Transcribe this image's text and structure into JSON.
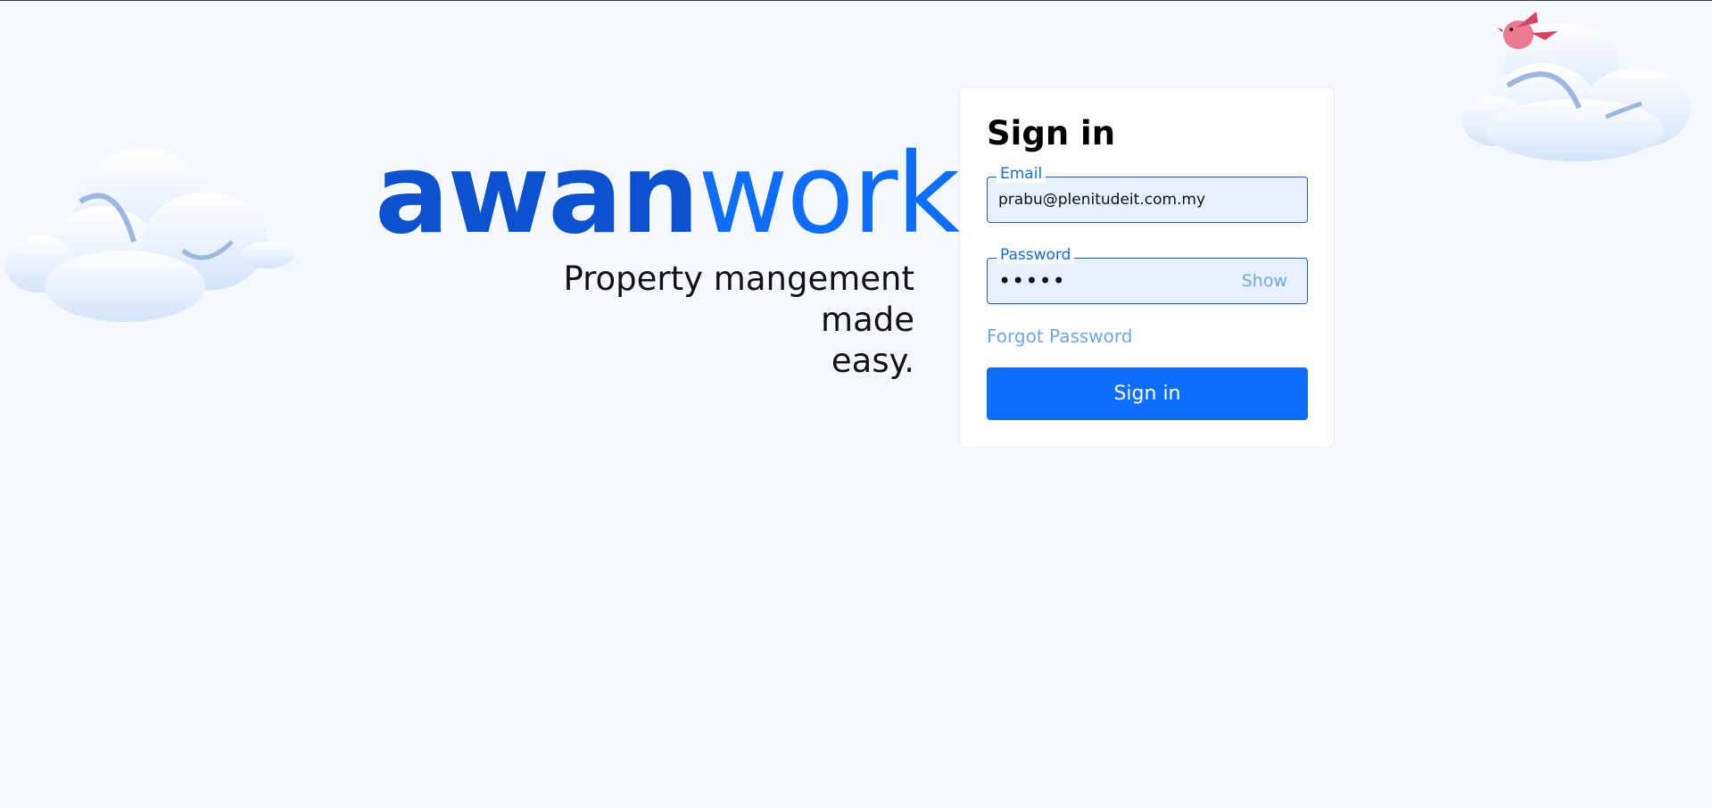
{
  "brand": {
    "logo_part1": "awan",
    "logo_part2": "works",
    "tagline_line1": "Property mangement made",
    "tagline_line2": "easy."
  },
  "signin": {
    "title": "Sign in",
    "email_label": "Email",
    "email_value": "prabu@plenitudeit.com.my",
    "password_label": "Password",
    "password_value": "•••••",
    "show_label": "Show",
    "forgot_label": "Forgot Password",
    "submit_label": "Sign in"
  },
  "colors": {
    "background": "#f5f9fe",
    "brand_dark": "#0a52d1",
    "brand_primary": "#0d6efd",
    "link": "#6ea8e8",
    "field_bg": "#e8f0fe"
  },
  "decor": {
    "left_icon": "cloud-icon",
    "right_icon": "cloud-icon",
    "bird_icon": "bird-icon"
  }
}
